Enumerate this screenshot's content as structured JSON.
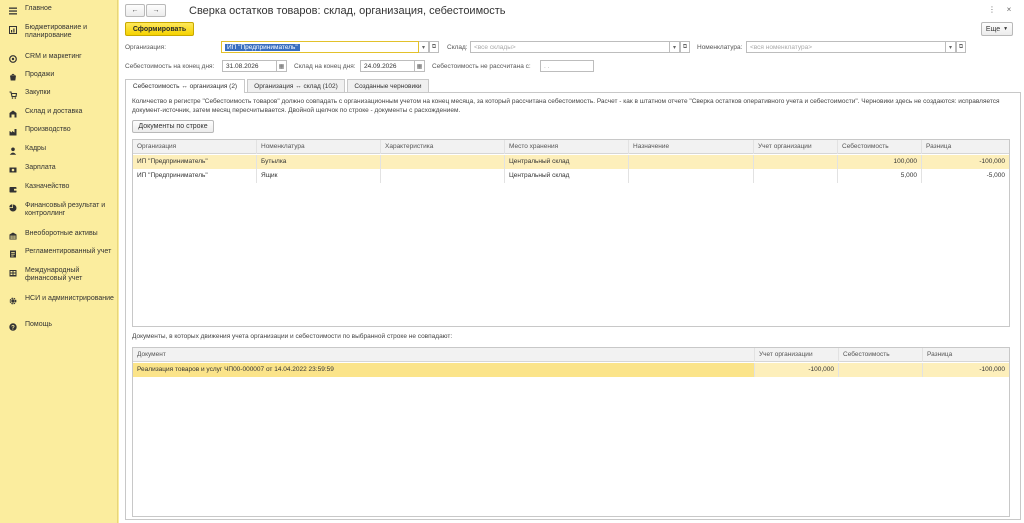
{
  "sidebar": {
    "items": [
      {
        "label": "Главное",
        "icon": "menu-lines-icon"
      },
      {
        "label": "Бюджетирование и планирование",
        "icon": "budget-icon"
      },
      {
        "label": "CRM и маркетинг",
        "icon": "crm-icon"
      },
      {
        "label": "Продажи",
        "icon": "sales-icon"
      },
      {
        "label": "Закупки",
        "icon": "purchase-icon"
      },
      {
        "label": "Склад и доставка",
        "icon": "warehouse-icon"
      },
      {
        "label": "Производство",
        "icon": "production-icon"
      },
      {
        "label": "Кадры",
        "icon": "hr-icon"
      },
      {
        "label": "Зарплата",
        "icon": "salary-icon"
      },
      {
        "label": "Казначейство",
        "icon": "treasury-icon"
      },
      {
        "label": "Финансовый результат и контроллинг",
        "icon": "finance-icon"
      },
      {
        "label": "Внеоборотные активы",
        "icon": "assets-icon"
      },
      {
        "label": "Регламентированный учет",
        "icon": "accounting-icon"
      },
      {
        "label": "Международный финансовый учет",
        "icon": "intl-finance-icon"
      },
      {
        "label": "НСИ и администрирование",
        "icon": "gear-icon"
      },
      {
        "label": "Помощь",
        "icon": "help-icon"
      }
    ]
  },
  "header": {
    "back": "←",
    "forward": "→",
    "title": "Сверка остатков товаров: склад, организация, себестоимость",
    "more": "⋮",
    "close": "×"
  },
  "toolbar": {
    "generate_label": "Сформировать",
    "more_label": "Еще"
  },
  "filters": {
    "org_label": "Организация:",
    "org_value": "ИП \"Предприниматель\"",
    "warehouse_label": "Склад:",
    "warehouse_placeholder": "<все склады>",
    "nomenclature_label": "Номенклатура:",
    "nomenclature_placeholder": "<вся номенклатура>",
    "cost_end_label": "Себестоимость на конец дня:",
    "cost_end_value": "31.08.2026",
    "warehouse_end_label": "Склад на конец дня:",
    "warehouse_end_value": "24.09.2026",
    "not_calculated_label": "Себестоимость не рассчитана с:",
    "not_calculated_value": " .  .   "
  },
  "tabs": [
    {
      "label": "Себестоимость ↔ организация (2)",
      "active": true
    },
    {
      "label": "Организация ↔ склад (102)",
      "active": false
    },
    {
      "label": "Созданные черновики",
      "active": false
    }
  ],
  "panel": {
    "info_text": "Количество в регистре \"Себестоимость товаров\" должно совпадать с организационным учетом на конец месяца, за который рассчитана себестоимость. Расчет - как в штатном отчете \"Сверка остатков оперативного учета и себестоимости\". Черновики здесь не создаются: исправляется документ-источник, затем месяц пересчитывается. Двойной щелчок по строке - документы с расхождением.",
    "docs_button": "Документы по строке"
  },
  "main_table": {
    "columns": [
      "Организация",
      "Номенклатура",
      "Характеристика",
      "Место хранения",
      "Назначение",
      "Учет организации",
      "Себестоимость",
      "Разница"
    ],
    "rows": [
      [
        "ИП \"Предприниматель\"",
        "Бутылка",
        "",
        "Центральный склад",
        "",
        "",
        "100,000",
        "-100,000"
      ],
      [
        "ИП \"Предприниматель\"",
        "Ящик",
        "",
        "Центральный склад",
        "",
        "",
        "5,000",
        "-5,000"
      ]
    ]
  },
  "docs_table": {
    "caption": "Документы, в которых движения учета организации и себестоимости по выбранной строке не совпадают:",
    "columns": [
      "Документ",
      "Учет организации",
      "Себестоимость",
      "Разница"
    ],
    "rows": [
      [
        "Реализация товаров и услуг ЧП00-000007 от 14.04.2022 23:59:59",
        "-100,000",
        "",
        "-100,000"
      ]
    ]
  },
  "colors": {
    "sidebar_bg": "#fbed9e",
    "accent_button": "#f5d200",
    "selected_row": "#fdefbb",
    "focus_border": "#e2c12b"
  }
}
